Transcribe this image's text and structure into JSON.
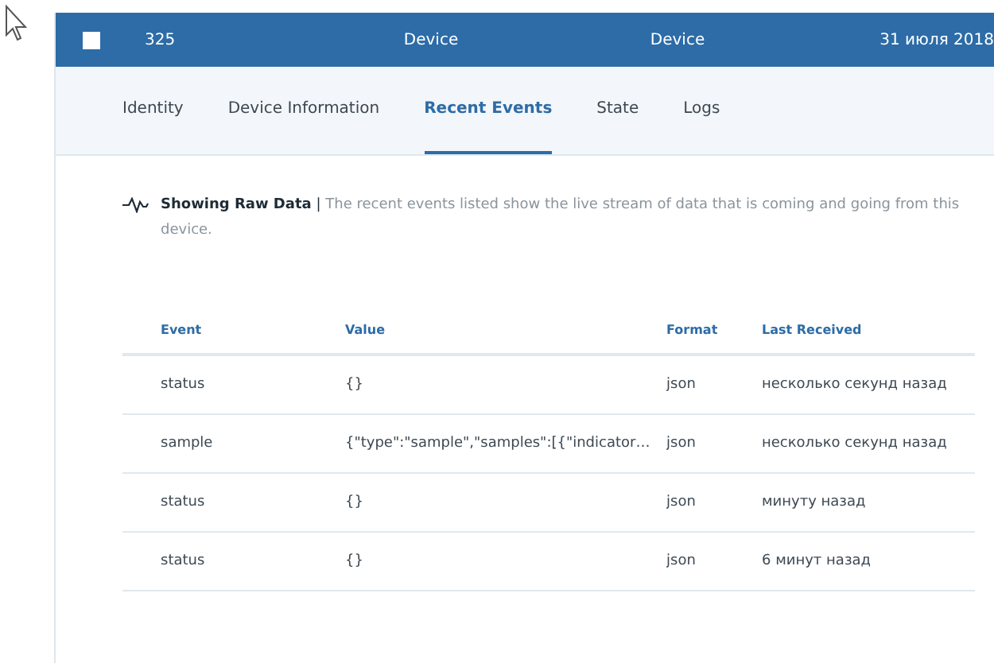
{
  "header": {
    "checked": false,
    "cells": [
      "325",
      "Device",
      "Device",
      "31 июля 2018"
    ]
  },
  "tabs": [
    {
      "label": "Identity",
      "selected": false
    },
    {
      "label": "Device Information",
      "selected": false
    },
    {
      "label": "Recent Events",
      "selected": true
    },
    {
      "label": "State",
      "selected": false
    },
    {
      "label": "Logs",
      "selected": false
    }
  ],
  "description": {
    "title": "Showing Raw Data",
    "separator": "|",
    "text": "The recent events listed show the live stream of data that is coming and going from this device."
  },
  "table": {
    "columns": [
      "Event",
      "Value",
      "Format",
      "Last Received"
    ],
    "rows": [
      [
        "status",
        "{}",
        "json",
        "несколько секунд назад"
      ],
      [
        "sample",
        "{\"type\":\"sample\",\"samples\":[{\"indicator…",
        "json",
        "несколько секунд назад"
      ],
      [
        "status",
        "{}",
        "json",
        "минуту назад"
      ],
      [
        "status",
        "{}",
        "json",
        "6 минут назад"
      ]
    ]
  }
}
